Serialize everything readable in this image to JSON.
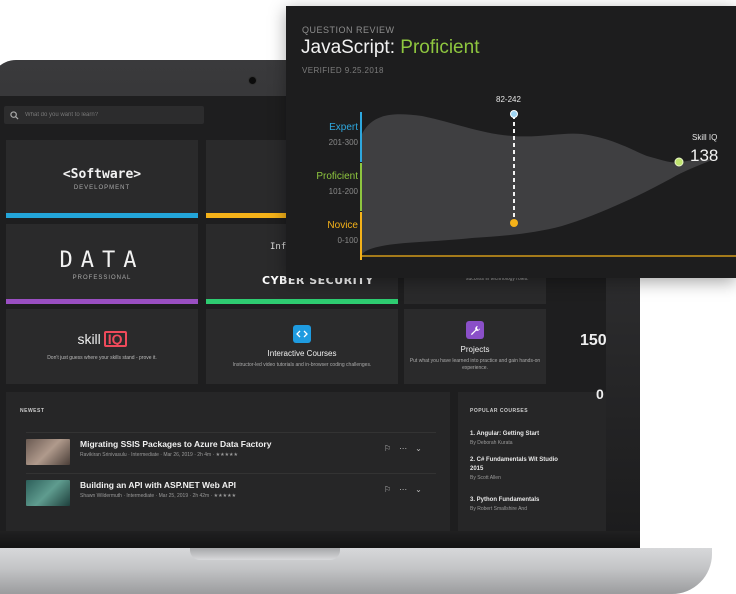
{
  "search": {
    "placeholder": "What do you want to learn?"
  },
  "tiles": {
    "software": {
      "title": "<Software>",
      "subtitle": "DEVELOPMENT"
    },
    "data": {
      "title": "DATA",
      "subtitle": "PROFESSIONAL"
    },
    "cyber": {
      "top": "Inf",
      "title": "CYBER SECURITY"
    },
    "top3_text": "success in technology roles."
  },
  "features": {
    "skill_iq": {
      "logo_text": "skill",
      "logo_iq": "IQ",
      "desc": "Don't just guess where your skills stand - prove it."
    },
    "interactive": {
      "title": "Interactive Courses",
      "desc": "Instructor-led video tutorials and in-browser coding challenges."
    },
    "projects": {
      "title": "Projects",
      "desc": "Put what you have learned into practice and gain hands-on experience."
    }
  },
  "stats": {
    "big": "150",
    "zero": "0"
  },
  "newest": {
    "label": "NEWEST",
    "courses": [
      {
        "title": "Migrating SSIS Packages to Azure Data Factory",
        "meta": "Ravikiran Srinivasulu · Intermediate · Mar 26, 2019 · 2h 4m · ★★★★★"
      },
      {
        "title": "Building an API with ASP.NET Web API",
        "meta": "Shawn Wildermuth · Intermediate · Mar 25, 2019 · 2h 42m · ★★★★★"
      }
    ]
  },
  "popular": {
    "label": "POPULAR COURSES",
    "items": [
      {
        "title": "1. Angular: Getting Start",
        "author": "By Deborah Kurata"
      },
      {
        "title": "2. C# Fundamentals Wit Studio 2015",
        "author": "By Scott Allen"
      },
      {
        "title": "3. Python Fundamentals",
        "author": "By Robert Smallshire And"
      }
    ]
  },
  "skill_card": {
    "overline": "QUESTION REVIEW",
    "subject": "JavaScript: ",
    "level": "Proficient",
    "verified": "VERIFIED 9.25.2018",
    "bands": [
      {
        "name": "Expert",
        "range": "201-300",
        "color": "#2ea8df"
      },
      {
        "name": "Proficient",
        "range": "101-200",
        "color": "#8ec63f"
      },
      {
        "name": "Novice",
        "range": "0-100",
        "color": "#f5b219"
      }
    ],
    "range_label": "82-242",
    "score_label": "Skill IQ",
    "score": "138"
  },
  "colors": {
    "software_bar": "#23a5d9",
    "yellow_bar": "#f5b219",
    "data_bar": "#9a4fc2",
    "cyber_bar": "#2ecc71",
    "skill_iq_red": "#ef4a5b",
    "interactive_icon": "#1e9be0",
    "projects_icon": "#8a4fc8"
  }
}
